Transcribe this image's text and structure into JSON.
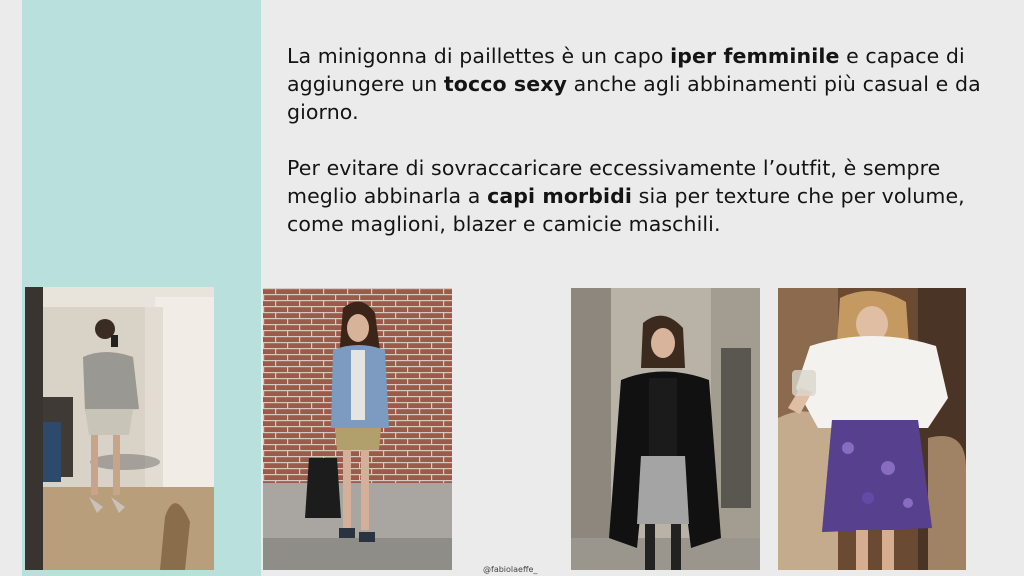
{
  "paragraphs": [
    {
      "p1_a": "La minigonna di paillettes è un capo ",
      "p1_b": "iper femminile",
      "p1_c": " e capace di aggiungere un ",
      "p1_d": "tocco sexy",
      "p1_e": " anche agli abbinamenti più casual e da giorno."
    },
    {
      "p2_a": "Per evitare di sovraccaricare eccessivamente l’outfit, è sempre meglio abbinarla a ",
      "p2_b": "capi morbidi",
      "p2_c": " sia per texture che per volume, come maglioni, blazer e camicie maschili."
    }
  ],
  "credit": "@fabiolaeffe_",
  "colors": {
    "background": "#ebebeb",
    "teal_panel": "#b9e0dc"
  },
  "photos": [
    {
      "name": "mirror-selfie-grey-sweater-silver-skirt"
    },
    {
      "name": "denim-jacket-gold-sequin-skirt-brick-wall"
    },
    {
      "name": "black-blazer-silver-sequin-skirt"
    },
    {
      "name": "white-shirt-purple-sequin-skirt"
    }
  ]
}
